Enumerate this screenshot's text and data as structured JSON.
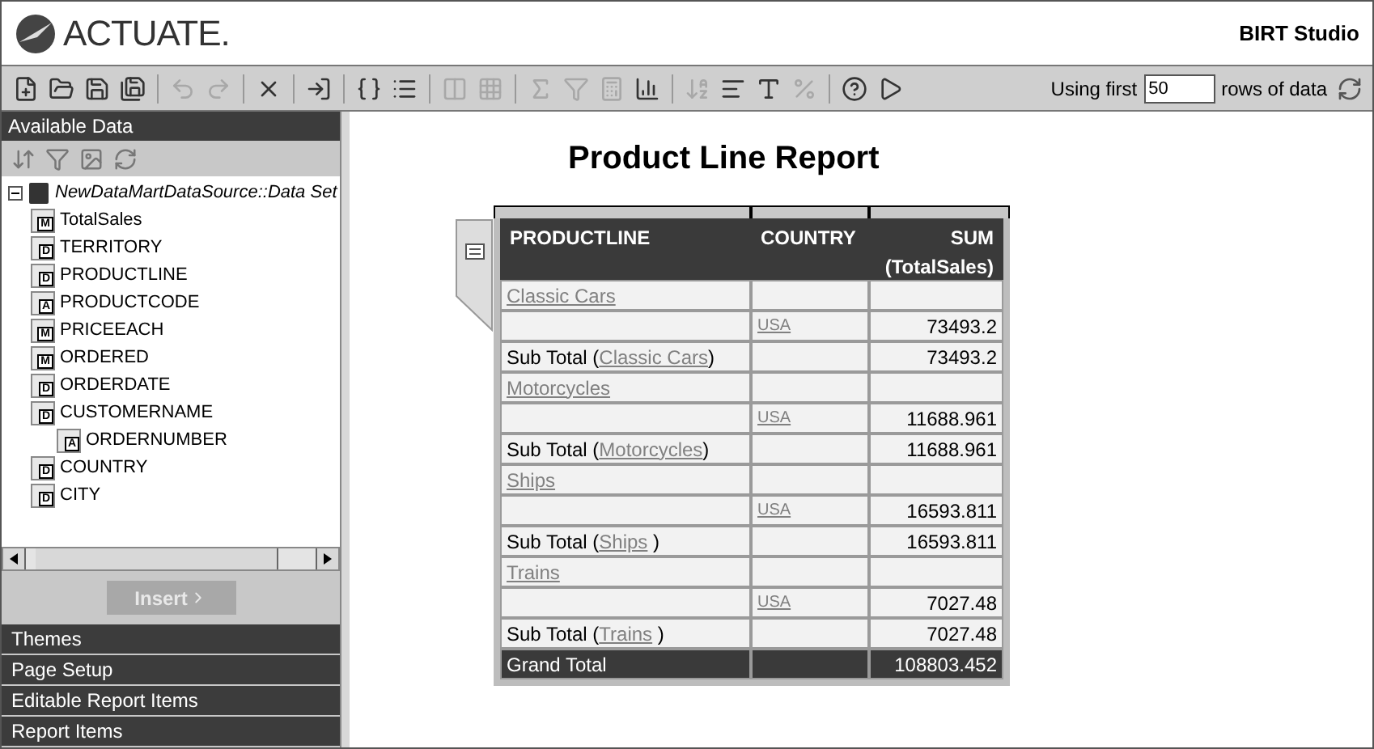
{
  "header": {
    "logo": "ACTUATE.",
    "app_title": "BIRT Studio"
  },
  "toolbar": {
    "buttons": [
      {
        "disabled": false
      },
      {
        "disabled": false
      },
      {
        "disabled": false
      },
      {
        "disabled": false
      },
      {
        "disabled": true
      },
      {
        "disabled": true
      },
      {
        "disabled": false
      },
      {
        "disabled": false
      },
      {
        "disabled": false
      },
      {
        "disabled": false
      },
      {
        "disabled": true
      },
      {
        "disabled": true
      },
      {
        "disabled": true
      },
      {
        "disabled": true
      },
      {
        "disabled": true
      },
      {
        "disabled": false
      },
      {
        "disabled": true
      },
      {
        "disabled": false
      },
      {
        "disabled": false
      },
      {
        "disabled": true
      },
      {
        "disabled": false
      },
      {
        "disabled": false
      }
    ],
    "rows_prefix": "Using first",
    "rows_value": "50",
    "rows_suffix": "rows of data"
  },
  "sidebar": {
    "title": "Available Data",
    "tree": {
      "label": "NewDataMartDataSource::Data Set",
      "expanded": true,
      "children": [
        {
          "label": "TotalSales",
          "badge": "M"
        },
        {
          "label": "TERRITORY",
          "badge": "D"
        },
        {
          "label": "PRODUCTLINE",
          "badge": "D"
        },
        {
          "label": "PRODUCTCODE",
          "badge": "A"
        },
        {
          "label": "PRICEEACH",
          "badge": "M"
        },
        {
          "label": "ORDERED",
          "badge": "M"
        },
        {
          "label": "ORDERDATE",
          "badge": "D"
        },
        {
          "label": "CUSTOMERNAME",
          "badge": "D",
          "children": [
            {
              "label": "ORDERNUMBER",
              "badge": "A"
            }
          ]
        },
        {
          "label": "COUNTRY",
          "badge": "D"
        },
        {
          "label": "CITY",
          "badge": "D"
        }
      ]
    },
    "insert_button": {
      "label": "Insert",
      "disabled": true
    },
    "sections": [
      "Themes",
      "Page Setup",
      "Editable Report Items",
      "Report Items"
    ]
  },
  "report": {
    "title": "Product Line Report",
    "columns": [
      "PRODUCTLINE",
      "COUNTRY",
      "SUM (TotalSales)"
    ],
    "rows": [
      {
        "kind": "group",
        "link": "Classic Cars"
      },
      {
        "kind": "detail",
        "link": "USA",
        "value": "73493.2"
      },
      {
        "kind": "subtotal",
        "prefix": "Sub Total (",
        "link": "Classic Cars",
        "suffix": ")",
        "value": "73493.2"
      },
      {
        "kind": "group",
        "link": "Motorcycles"
      },
      {
        "kind": "detail",
        "link": "USA",
        "value": "11688.961"
      },
      {
        "kind": "subtotal",
        "prefix": "Sub Total (",
        "link": "Motorcycles",
        "suffix": ")",
        "value": "11688.961"
      },
      {
        "kind": "group",
        "link": "Ships"
      },
      {
        "kind": "detail",
        "link": "USA",
        "value": "16593.811"
      },
      {
        "kind": "subtotal",
        "prefix": "Sub Total (",
        "link": "Ships",
        "suffix": " )",
        "value": "16593.811"
      },
      {
        "kind": "group",
        "link": "Trains"
      },
      {
        "kind": "detail",
        "link": "USA",
        "value": "7027.48"
      },
      {
        "kind": "subtotal",
        "prefix": "Sub Total (",
        "link": "Trains",
        "suffix": " )",
        "value": "7027.48"
      },
      {
        "kind": "grandtotal",
        "label": "Grand Total",
        "value": "108803.452"
      }
    ]
  }
}
